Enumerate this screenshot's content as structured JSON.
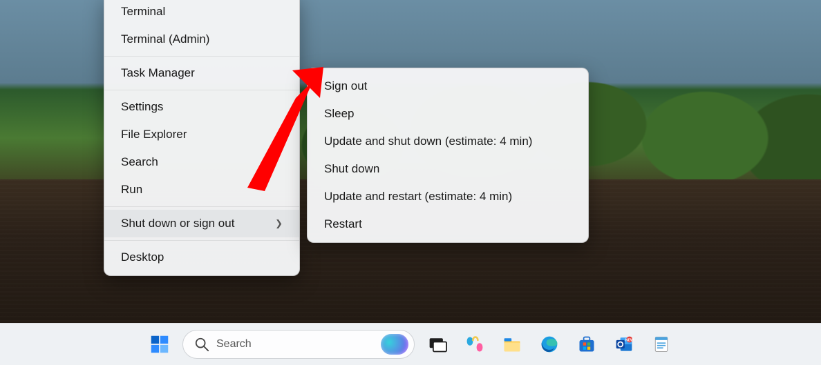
{
  "main_menu": {
    "items": [
      {
        "label": "Terminal",
        "hover": false,
        "sep_after": false
      },
      {
        "label": "Terminal (Admin)",
        "hover": false,
        "sep_after": true
      },
      {
        "label": "Task Manager",
        "hover": false,
        "sep_after": true
      },
      {
        "label": "Settings",
        "hover": false,
        "sep_after": false
      },
      {
        "label": "File Explorer",
        "hover": false,
        "sep_after": false
      },
      {
        "label": "Search",
        "hover": false,
        "sep_after": false
      },
      {
        "label": "Run",
        "hover": false,
        "sep_after": true
      },
      {
        "label": "Shut down or sign out",
        "hover": true,
        "has_submenu": true,
        "sep_after": true
      },
      {
        "label": "Desktop",
        "hover": false,
        "sep_after": false
      }
    ]
  },
  "sub_menu": {
    "items": [
      {
        "label": "Sign out"
      },
      {
        "label": "Sleep"
      },
      {
        "label": "Update and shut down (estimate: 4 min)"
      },
      {
        "label": "Shut down"
      },
      {
        "label": "Update and restart (estimate: 4 min)"
      },
      {
        "label": "Restart"
      }
    ]
  },
  "taskbar": {
    "search_placeholder": "Search",
    "icons": {
      "start": "start-icon",
      "taskview": "task-view-icon",
      "copilot": "copilot-icon",
      "explorer": "file-explorer-icon",
      "edge": "edge-icon",
      "store": "microsoft-store-icon",
      "outlook": "outlook-icon",
      "notepad": "notepad-icon"
    }
  },
  "annotation": {
    "arrow_color": "#ff0000",
    "arrow_points_to": "Sign out"
  }
}
